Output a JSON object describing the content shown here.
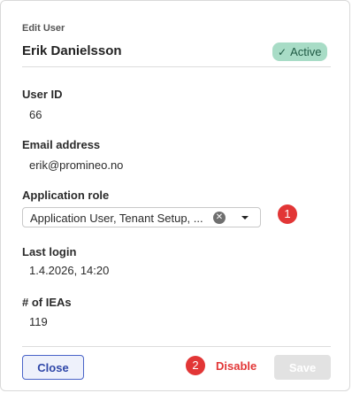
{
  "dialog": {
    "caption": "Edit User",
    "user_name": "Erik Danielsson",
    "status": "Active",
    "status_icon": "check-icon"
  },
  "fields": {
    "user_id": {
      "label": "User ID",
      "value": "66"
    },
    "email": {
      "label": "Email address",
      "value": "erik@promineo.no"
    },
    "role": {
      "label": "Application role",
      "value": "Application User, Tenant Setup, ..."
    },
    "last_login": {
      "label": "Last login",
      "value": "1.4.2026, 14:20"
    },
    "ieas": {
      "label": "# of IEAs",
      "value": "119"
    }
  },
  "markers": [
    "1",
    "2"
  ],
  "footer": {
    "close_label": "Close",
    "disable_label": "Disable",
    "save_label": "Save"
  },
  "colors": {
    "status_badge": "#a8dcc6",
    "primary": "#4a64c8",
    "danger": "#e23636",
    "disabled": "#e2e2e2"
  }
}
